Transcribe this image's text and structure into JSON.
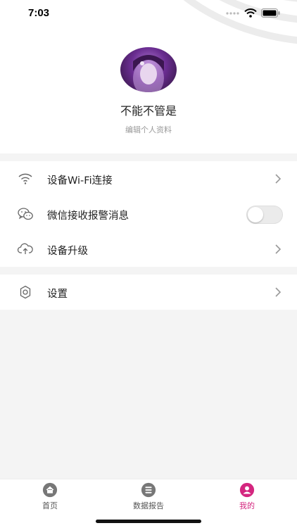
{
  "status_bar": {
    "time": "7:03"
  },
  "profile": {
    "username": "不能不管是",
    "edit_label": "编辑个人资料"
  },
  "menu": [
    {
      "label": "设备Wi-Fi连接",
      "icon": "wifi-icon",
      "type": "link"
    },
    {
      "label": "微信接收报警消息",
      "icon": "wechat-icon",
      "type": "toggle",
      "enabled": false
    },
    {
      "label": "设备升级",
      "icon": "cloud-upload-icon",
      "type": "link"
    }
  ],
  "settings": {
    "label": "设置",
    "icon": "gear-icon"
  },
  "tabbar": {
    "tabs": [
      {
        "label": "首页",
        "icon": "home-icon",
        "active": false
      },
      {
        "label": "数据报告",
        "icon": "list-icon",
        "active": false
      },
      {
        "label": "我的",
        "icon": "user-icon",
        "active": true
      }
    ]
  },
  "colors": {
    "accent": "#d4267f",
    "icon_gray": "#666666",
    "background": "#f4f4f4"
  }
}
